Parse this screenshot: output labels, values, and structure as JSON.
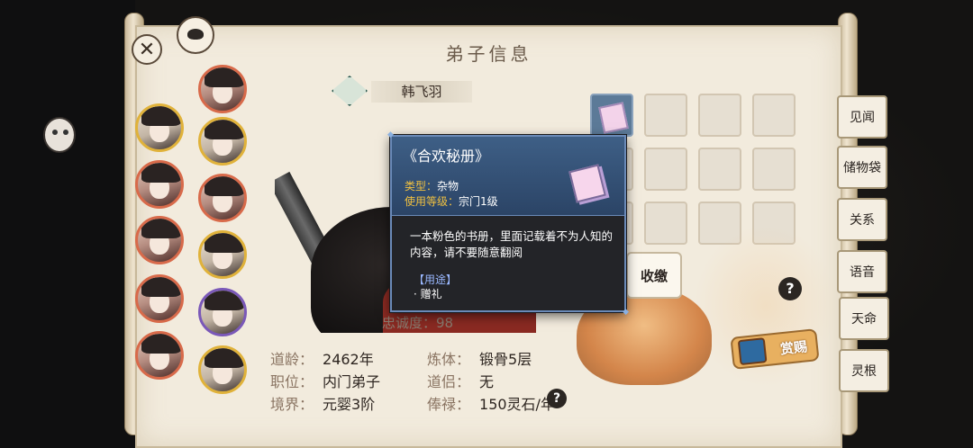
{
  "window": {
    "title": "弟子信息"
  },
  "character": {
    "name": "韩飞羽",
    "loyalty_label": "忠诚度：",
    "loyalty_value": "98"
  },
  "stats": [
    {
      "label": "道龄：",
      "value": "2462年"
    },
    {
      "label": "炼体：",
      "value": "锻骨5层"
    },
    {
      "label": "职位：",
      "value": "内门弟子"
    },
    {
      "label": "道侣：",
      "value": "无"
    },
    {
      "label": "境界：",
      "value": "元婴3阶"
    },
    {
      "label": "俸禄：",
      "value": "150灵石/年"
    }
  ],
  "tooltip": {
    "title": "《合欢秘册》",
    "type_label": "类型：",
    "type_value": "杂物",
    "level_label": "使用等级：",
    "level_value": "宗门1级",
    "description": "一本粉色的书册，里面记载着不为人知的内容，请不要随意翻阅",
    "use_header": "【用途】",
    "use_item": "· 赠礼"
  },
  "buttons": {
    "donate": "收缴",
    "reward": "赏赐",
    "help": "?"
  },
  "side_tabs": [
    "见闻",
    "储物袋",
    "关系",
    "语音",
    "天命",
    "灵根"
  ],
  "inventory": {
    "filled_slots": 1,
    "total_slots": 12
  },
  "icons": [
    "close-icon",
    "sword-icon",
    "help-icon",
    "book-icon",
    "reward-chest-icon"
  ],
  "colors": {
    "tooltip_border": "#6a8ab8",
    "tooltip_key": "#f0c040",
    "use_header": "#9ab8ff"
  }
}
